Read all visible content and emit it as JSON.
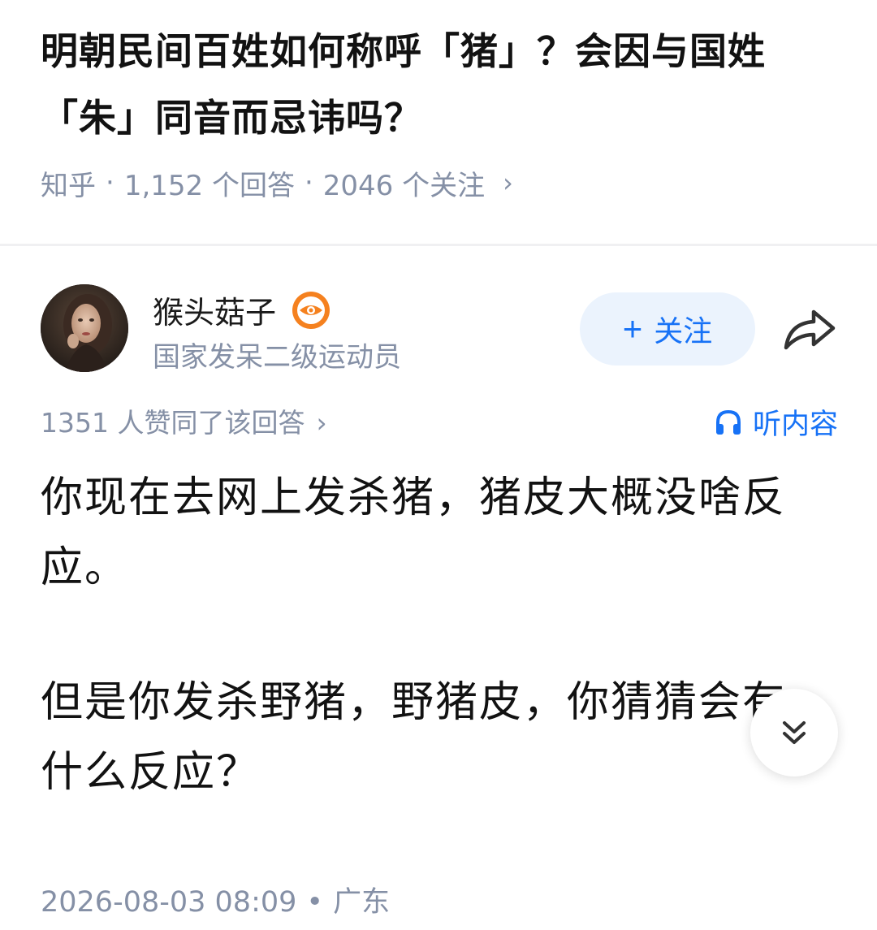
{
  "question": {
    "title": "明朝民间百姓如何称呼「猪」？会因与国姓「朱」同音而忌讳吗？",
    "source": "知乎",
    "answers": "1,152 个回答",
    "followers": "2046 个关注",
    "chevron_icon": "chevron-right-icon"
  },
  "author": {
    "name": "猴头菇子",
    "bio": "国家发呆二级运动员",
    "badge_icon": "eye-badge-icon",
    "badge_color": "#f5811f",
    "follow_label": "关注",
    "follow_icon": "plus-icon",
    "share_icon": "share-icon"
  },
  "stats": {
    "likes_text": "1351 人赞同了该回答",
    "listen_label": "听内容",
    "listen_icon": "headphones-icon"
  },
  "answer": {
    "paragraphs": [
      "你现在去网上发杀猪，猪皮大概没啥反应。",
      "但是你发杀野猪，野猪皮，你猜猜会有什么反应？"
    ],
    "expand_icon": "double-chevron-down-icon"
  },
  "footer": {
    "datetime": "2026-08-03 08:09",
    "location": "广东"
  },
  "colors": {
    "accent": "#1772f6",
    "muted": "#8590a6",
    "text": "#121212"
  }
}
